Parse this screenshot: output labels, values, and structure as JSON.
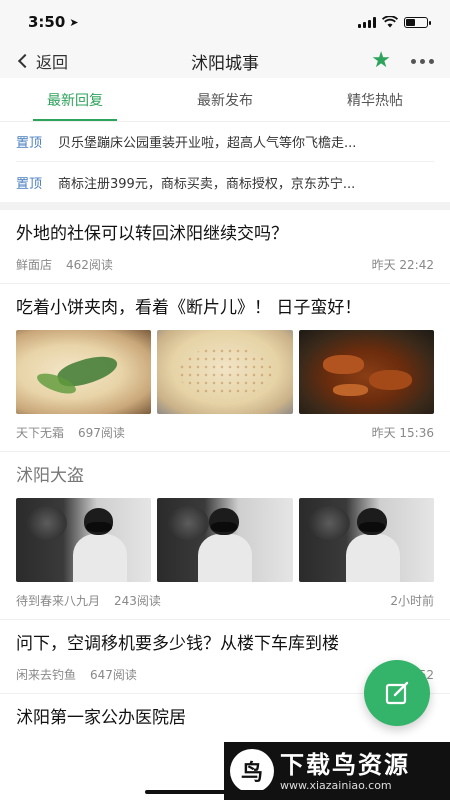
{
  "status": {
    "time": "3:50"
  },
  "nav": {
    "back_label": "返回",
    "title": "沭阳城事"
  },
  "tabs": [
    {
      "label": "最新回复",
      "active": true
    },
    {
      "label": "最新发布",
      "active": false
    },
    {
      "label": "精华热帖",
      "active": false
    }
  ],
  "pinned": [
    {
      "tag": "置顶",
      "text": "贝乐堡蹦床公园重装开业啦，超高人气等你飞檐走..."
    },
    {
      "tag": "置顶",
      "text": "商标注册399元，商标买卖，商标授权，京东苏宁..."
    }
  ],
  "posts": [
    {
      "title": "外地的社保可以转回沭阳继续交吗？",
      "author": "鲜面店",
      "reads": "462阅读",
      "time": "昨天 22:42"
    },
    {
      "title": "吃着小饼夹肉，看着《断片儿》！ 日子蛮好！",
      "author": "天下无霜",
      "reads": "697阅读",
      "time": "昨天 15:36"
    },
    {
      "title": "沭阳大盗",
      "author": "待到春来八九月",
      "reads": "243阅读",
      "time": "2小时前"
    },
    {
      "title": "问下，空调移机要多少钱？从楼下车库到楼",
      "author": "闲来去钓鱼",
      "reads": "647阅读",
      "time": "昨天 16:52"
    },
    {
      "title": "沭阳第一家公办医院居",
      "author": "",
      "reads": "",
      "time": ""
    }
  ],
  "watermark": {
    "logo_char": "鸟",
    "title": "下载鸟资源",
    "url": "www.xiazainiao.com"
  },
  "colors": {
    "accent": "#2ea35b",
    "pin_tag": "#4a7fc0",
    "fab": "#34b36a"
  }
}
